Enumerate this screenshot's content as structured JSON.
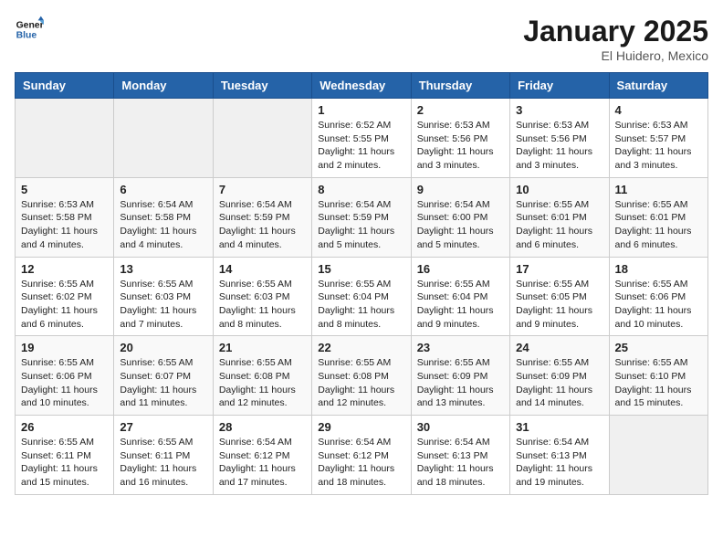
{
  "header": {
    "logo_line1": "General",
    "logo_line2": "Blue",
    "month": "January 2025",
    "location": "El Huidero, Mexico"
  },
  "weekdays": [
    "Sunday",
    "Monday",
    "Tuesday",
    "Wednesday",
    "Thursday",
    "Friday",
    "Saturday"
  ],
  "weeks": [
    [
      {
        "day": "",
        "sunrise": "",
        "sunset": "",
        "daylight": ""
      },
      {
        "day": "",
        "sunrise": "",
        "sunset": "",
        "daylight": ""
      },
      {
        "day": "",
        "sunrise": "",
        "sunset": "",
        "daylight": ""
      },
      {
        "day": "1",
        "sunrise": "Sunrise: 6:52 AM",
        "sunset": "Sunset: 5:55 PM",
        "daylight": "Daylight: 11 hours and 2 minutes."
      },
      {
        "day": "2",
        "sunrise": "Sunrise: 6:53 AM",
        "sunset": "Sunset: 5:56 PM",
        "daylight": "Daylight: 11 hours and 3 minutes."
      },
      {
        "day": "3",
        "sunrise": "Sunrise: 6:53 AM",
        "sunset": "Sunset: 5:56 PM",
        "daylight": "Daylight: 11 hours and 3 minutes."
      },
      {
        "day": "4",
        "sunrise": "Sunrise: 6:53 AM",
        "sunset": "Sunset: 5:57 PM",
        "daylight": "Daylight: 11 hours and 3 minutes."
      }
    ],
    [
      {
        "day": "5",
        "sunrise": "Sunrise: 6:53 AM",
        "sunset": "Sunset: 5:58 PM",
        "daylight": "Daylight: 11 hours and 4 minutes."
      },
      {
        "day": "6",
        "sunrise": "Sunrise: 6:54 AM",
        "sunset": "Sunset: 5:58 PM",
        "daylight": "Daylight: 11 hours and 4 minutes."
      },
      {
        "day": "7",
        "sunrise": "Sunrise: 6:54 AM",
        "sunset": "Sunset: 5:59 PM",
        "daylight": "Daylight: 11 hours and 4 minutes."
      },
      {
        "day": "8",
        "sunrise": "Sunrise: 6:54 AM",
        "sunset": "Sunset: 5:59 PM",
        "daylight": "Daylight: 11 hours and 5 minutes."
      },
      {
        "day": "9",
        "sunrise": "Sunrise: 6:54 AM",
        "sunset": "Sunset: 6:00 PM",
        "daylight": "Daylight: 11 hours and 5 minutes."
      },
      {
        "day": "10",
        "sunrise": "Sunrise: 6:55 AM",
        "sunset": "Sunset: 6:01 PM",
        "daylight": "Daylight: 11 hours and 6 minutes."
      },
      {
        "day": "11",
        "sunrise": "Sunrise: 6:55 AM",
        "sunset": "Sunset: 6:01 PM",
        "daylight": "Daylight: 11 hours and 6 minutes."
      }
    ],
    [
      {
        "day": "12",
        "sunrise": "Sunrise: 6:55 AM",
        "sunset": "Sunset: 6:02 PM",
        "daylight": "Daylight: 11 hours and 6 minutes."
      },
      {
        "day": "13",
        "sunrise": "Sunrise: 6:55 AM",
        "sunset": "Sunset: 6:03 PM",
        "daylight": "Daylight: 11 hours and 7 minutes."
      },
      {
        "day": "14",
        "sunrise": "Sunrise: 6:55 AM",
        "sunset": "Sunset: 6:03 PM",
        "daylight": "Daylight: 11 hours and 8 minutes."
      },
      {
        "day": "15",
        "sunrise": "Sunrise: 6:55 AM",
        "sunset": "Sunset: 6:04 PM",
        "daylight": "Daylight: 11 hours and 8 minutes."
      },
      {
        "day": "16",
        "sunrise": "Sunrise: 6:55 AM",
        "sunset": "Sunset: 6:04 PM",
        "daylight": "Daylight: 11 hours and 9 minutes."
      },
      {
        "day": "17",
        "sunrise": "Sunrise: 6:55 AM",
        "sunset": "Sunset: 6:05 PM",
        "daylight": "Daylight: 11 hours and 9 minutes."
      },
      {
        "day": "18",
        "sunrise": "Sunrise: 6:55 AM",
        "sunset": "Sunset: 6:06 PM",
        "daylight": "Daylight: 11 hours and 10 minutes."
      }
    ],
    [
      {
        "day": "19",
        "sunrise": "Sunrise: 6:55 AM",
        "sunset": "Sunset: 6:06 PM",
        "daylight": "Daylight: 11 hours and 10 minutes."
      },
      {
        "day": "20",
        "sunrise": "Sunrise: 6:55 AM",
        "sunset": "Sunset: 6:07 PM",
        "daylight": "Daylight: 11 hours and 11 minutes."
      },
      {
        "day": "21",
        "sunrise": "Sunrise: 6:55 AM",
        "sunset": "Sunset: 6:08 PM",
        "daylight": "Daylight: 11 hours and 12 minutes."
      },
      {
        "day": "22",
        "sunrise": "Sunrise: 6:55 AM",
        "sunset": "Sunset: 6:08 PM",
        "daylight": "Daylight: 11 hours and 12 minutes."
      },
      {
        "day": "23",
        "sunrise": "Sunrise: 6:55 AM",
        "sunset": "Sunset: 6:09 PM",
        "daylight": "Daylight: 11 hours and 13 minutes."
      },
      {
        "day": "24",
        "sunrise": "Sunrise: 6:55 AM",
        "sunset": "Sunset: 6:09 PM",
        "daylight": "Daylight: 11 hours and 14 minutes."
      },
      {
        "day": "25",
        "sunrise": "Sunrise: 6:55 AM",
        "sunset": "Sunset: 6:10 PM",
        "daylight": "Daylight: 11 hours and 15 minutes."
      }
    ],
    [
      {
        "day": "26",
        "sunrise": "Sunrise: 6:55 AM",
        "sunset": "Sunset: 6:11 PM",
        "daylight": "Daylight: 11 hours and 15 minutes."
      },
      {
        "day": "27",
        "sunrise": "Sunrise: 6:55 AM",
        "sunset": "Sunset: 6:11 PM",
        "daylight": "Daylight: 11 hours and 16 minutes."
      },
      {
        "day": "28",
        "sunrise": "Sunrise: 6:54 AM",
        "sunset": "Sunset: 6:12 PM",
        "daylight": "Daylight: 11 hours and 17 minutes."
      },
      {
        "day": "29",
        "sunrise": "Sunrise: 6:54 AM",
        "sunset": "Sunset: 6:12 PM",
        "daylight": "Daylight: 11 hours and 18 minutes."
      },
      {
        "day": "30",
        "sunrise": "Sunrise: 6:54 AM",
        "sunset": "Sunset: 6:13 PM",
        "daylight": "Daylight: 11 hours and 18 minutes."
      },
      {
        "day": "31",
        "sunrise": "Sunrise: 6:54 AM",
        "sunset": "Sunset: 6:13 PM",
        "daylight": "Daylight: 11 hours and 19 minutes."
      },
      {
        "day": "",
        "sunrise": "",
        "sunset": "",
        "daylight": ""
      }
    ]
  ]
}
